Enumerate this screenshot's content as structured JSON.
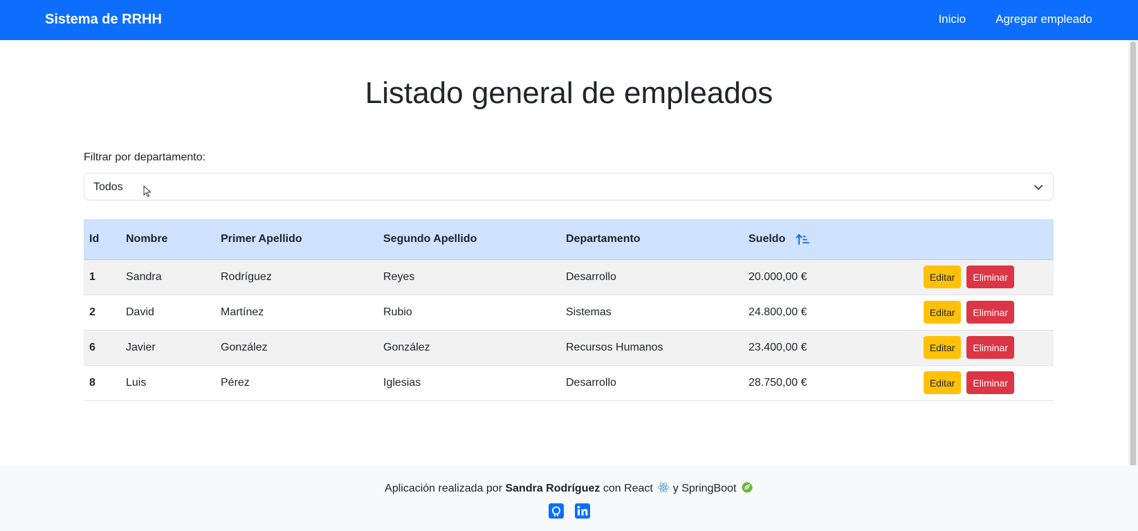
{
  "navbar": {
    "brand": "Sistema de RRHH",
    "links": [
      {
        "label": "Inicio"
      },
      {
        "label": "Agregar empleado"
      }
    ],
    "background": "#0d6efd"
  },
  "main": {
    "title": "Listado general de empleados",
    "filter": {
      "label": "Filtrar por departamento:",
      "selected": "Todos"
    },
    "table": {
      "headers": {
        "id": "Id",
        "nombre": "Nombre",
        "primer_apellido": "Primer Apellido",
        "segundo_apellido": "Segundo Apellido",
        "departamento": "Departamento",
        "sueldo": "Sueldo"
      },
      "sort_icon": "sort-ascending-icon",
      "rows": [
        {
          "id": "1",
          "nombre": "Sandra",
          "primer_apellido": "Rodríguez",
          "segundo_apellido": "Reyes",
          "departamento": "Desarrollo",
          "sueldo": "20.000,00 €"
        },
        {
          "id": "2",
          "nombre": "David",
          "primer_apellido": "Martínez",
          "segundo_apellido": "Rubio",
          "departamento": "Sistemas",
          "sueldo": "24.800,00 €"
        },
        {
          "id": "6",
          "nombre": "Javier",
          "primer_apellido": "González",
          "segundo_apellido": "González",
          "departamento": "Recursos Humanos",
          "sueldo": "23.400,00 €"
        },
        {
          "id": "8",
          "nombre": "Luis",
          "primer_apellido": "Pérez",
          "segundo_apellido": "Iglesias",
          "departamento": "Desarrollo",
          "sueldo": "28.750,00 €"
        }
      ],
      "actions": {
        "edit_label": "Editar",
        "delete_label": "Eliminar"
      }
    }
  },
  "footer": {
    "text_prefix": "Aplicación realizada por",
    "author": "Sandra Rodríguez",
    "text_middle": "con React",
    "text_and": "y SpringBoot",
    "icons": [
      "react-icon",
      "spring-icon",
      "github-icon",
      "linkedin-icon"
    ]
  },
  "colors": {
    "primary": "#0d6efd",
    "table_header": "#cfe2ff",
    "edit": "#ffc107",
    "delete": "#dc3545"
  }
}
